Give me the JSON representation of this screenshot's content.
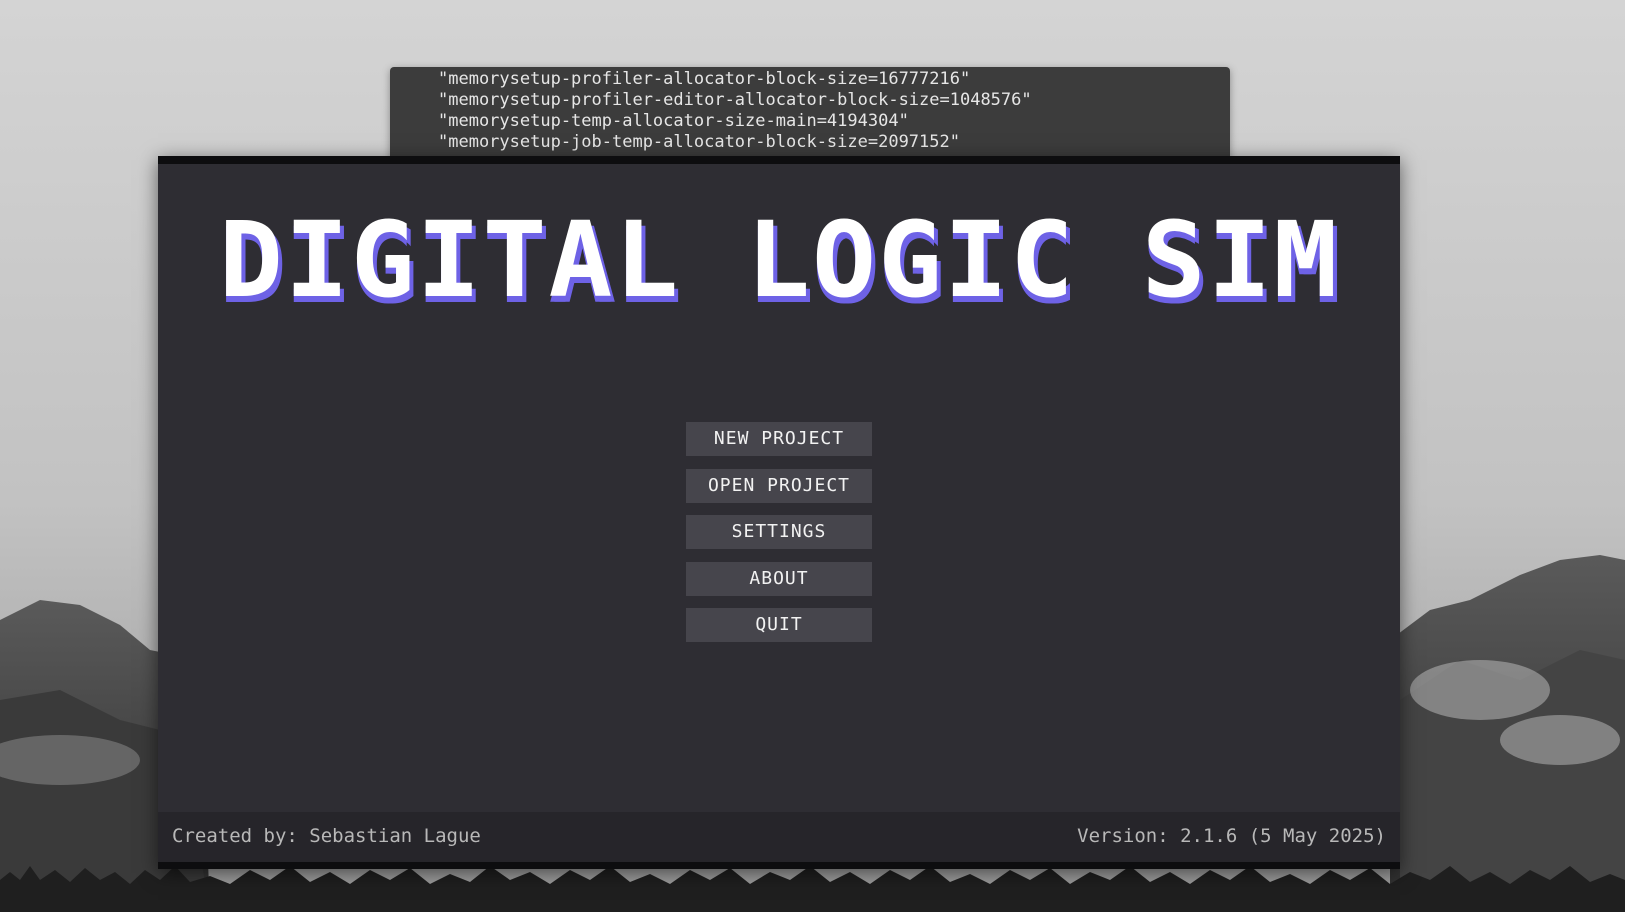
{
  "log": {
    "lines": [
      "\"memorysetup-profiler-allocator-block-size=16777216\"",
      "\"memorysetup-profiler-editor-allocator-block-size=1048576\"",
      "\"memorysetup-temp-allocator-size-main=4194304\"",
      "\"memorysetup-job-temp-allocator-block-size=2097152\""
    ]
  },
  "app": {
    "title": "DIGITAL LOGIC SIM",
    "menu": {
      "new_project": "NEW PROJECT",
      "open_project": "OPEN PROJECT",
      "settings": "SETTINGS",
      "about": "ABOUT",
      "quit": "QUIT"
    },
    "footer": {
      "credit": "Created by: Sebastian Lague",
      "version": "Version: 2.1.6 (5 May 2025)"
    },
    "colors": {
      "background": "#2e2d33",
      "button": "#46454c",
      "title_shadow": "#6e62e6",
      "footer": "#26252a"
    }
  },
  "wallpaper": {
    "description_icon": "mountain-landscape-icon"
  }
}
